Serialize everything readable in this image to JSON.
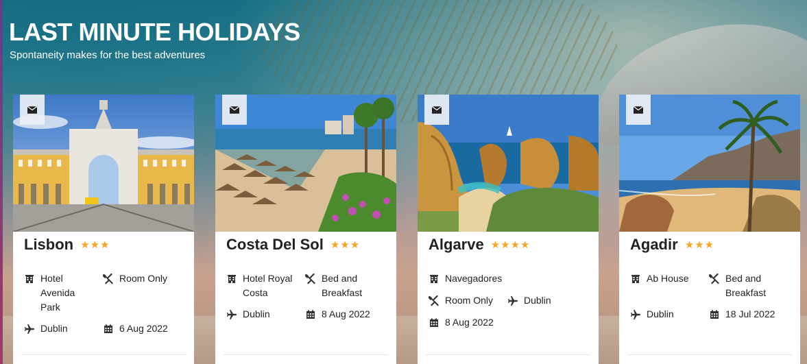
{
  "page": {
    "title": "LAST MINUTE HOLIDAYS",
    "subtitle": "Spontaneity makes for the best adventures"
  },
  "colors": {
    "star": "#f5a623",
    "text": "#222222",
    "icon": "#333333",
    "mail_button_bg": "#ebf0f5"
  },
  "cards": [
    {
      "destination": "Lisbon",
      "stars": "★★★",
      "hotel": "Hotel\nAvenida\nPark",
      "board": "Room Only",
      "departure": "Dublin",
      "date": "6 Aug 2022"
    },
    {
      "destination": "Costa Del Sol",
      "stars": "★★★",
      "hotel": "Hotel Royal\nCosta",
      "board": "Bed and\nBreakfast",
      "departure": "Dublin",
      "date": "8 Aug 2022"
    },
    {
      "destination": "Algarve",
      "stars": "★★★★",
      "hotel": "Navegadores",
      "board": "Room Only",
      "departure": "Dublin",
      "date": "8 Aug 2022"
    },
    {
      "destination": "Agadir",
      "stars": "★★★",
      "hotel": "Ab House",
      "board": "Bed and\nBreakfast",
      "departure": "Dublin",
      "date": "18 Jul 2022"
    }
  ],
  "icons": {
    "mail": "envelope-icon",
    "hotel": "building-icon",
    "board": "cutlery-icon",
    "departure": "plane-icon",
    "date": "calendar-icon"
  }
}
